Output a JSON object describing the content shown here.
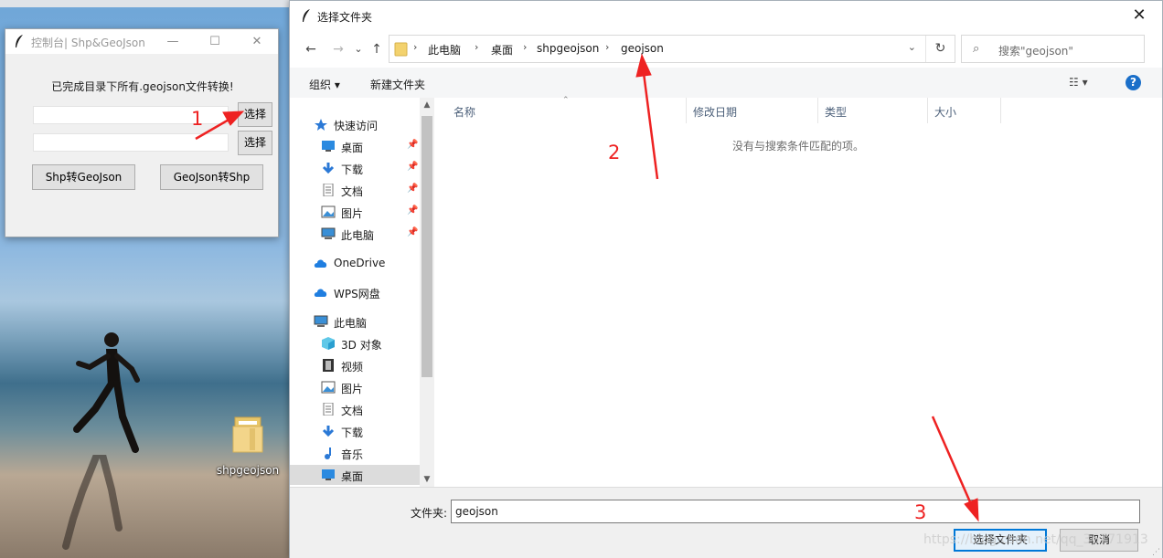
{
  "desktop": {
    "folder_label": "shpgeojson"
  },
  "tk_window": {
    "title": "控制台| Shp&GeoJson",
    "status_text": "已完成目录下所有.geojson文件转换!",
    "select_btn_1": "选择",
    "select_btn_2": "选择",
    "input1_value": "",
    "input2_value": "",
    "shp_to_geojson_btn": "Shp转GeoJson",
    "geojson_to_shp_btn": "GeoJson转Shp",
    "minimize_glyph": "—",
    "maximize_glyph": "☐",
    "close_glyph": "✕"
  },
  "dialog": {
    "title": "选择文件夹",
    "close_glyph": "✕",
    "nav": {
      "back": "←",
      "forward": "→",
      "recent": "⌄",
      "up": "↑"
    },
    "breadcrumb": [
      "此电脑",
      "桌面",
      "shpgeojson",
      "geojson"
    ],
    "breadcrumb_sep": "›",
    "search_placeholder": "搜索\"geojson\"",
    "toolbar": {
      "organize": "组织 ▾",
      "new_folder": "新建文件夹",
      "view": "☷ ▾",
      "help": "?"
    },
    "nav_items": [
      {
        "label": "快速访问",
        "icon": "star-icon",
        "pinned": false
      },
      {
        "label": "桌面",
        "icon": "desktop-icon",
        "pinned": true
      },
      {
        "label": "下载",
        "icon": "download-icon",
        "pinned": true
      },
      {
        "label": "文档",
        "icon": "document-icon",
        "pinned": true
      },
      {
        "label": "图片",
        "icon": "picture-icon",
        "pinned": true
      },
      {
        "label": "此电脑",
        "icon": "computer-icon",
        "pinned": true
      },
      {
        "label": "OneDrive",
        "icon": "cloud-icon",
        "pinned": false
      },
      {
        "label": "WPS网盘",
        "icon": "cloud-icon",
        "pinned": false
      },
      {
        "label": "此电脑",
        "icon": "computer-icon",
        "pinned": false
      },
      {
        "label": "3D 对象",
        "icon": "cube-icon",
        "pinned": false
      },
      {
        "label": "视频",
        "icon": "video-icon",
        "pinned": false
      },
      {
        "label": "图片",
        "icon": "picture-icon",
        "pinned": false
      },
      {
        "label": "文档",
        "icon": "document-icon",
        "pinned": false
      },
      {
        "label": "下载",
        "icon": "download-icon",
        "pinned": false
      },
      {
        "label": "音乐",
        "icon": "music-icon",
        "pinned": false
      },
      {
        "label": "桌面",
        "icon": "desktop-icon",
        "pinned": false,
        "selected": true
      }
    ],
    "columns": [
      "名称",
      "修改日期",
      "类型",
      "大小"
    ],
    "empty_message": "没有与搜索条件匹配的项。",
    "folder_label": "文件夹:",
    "folder_value": "geojson",
    "select_folder_btn": "选择文件夹",
    "cancel_btn": "取消"
  },
  "annotations": {
    "num1": "1",
    "num2": "2",
    "num3": "3",
    "watermark": "https://blog.csdn.net/qq_36771913"
  },
  "colors": {
    "annotation": "#ee2222",
    "accent": "#0078d7"
  }
}
